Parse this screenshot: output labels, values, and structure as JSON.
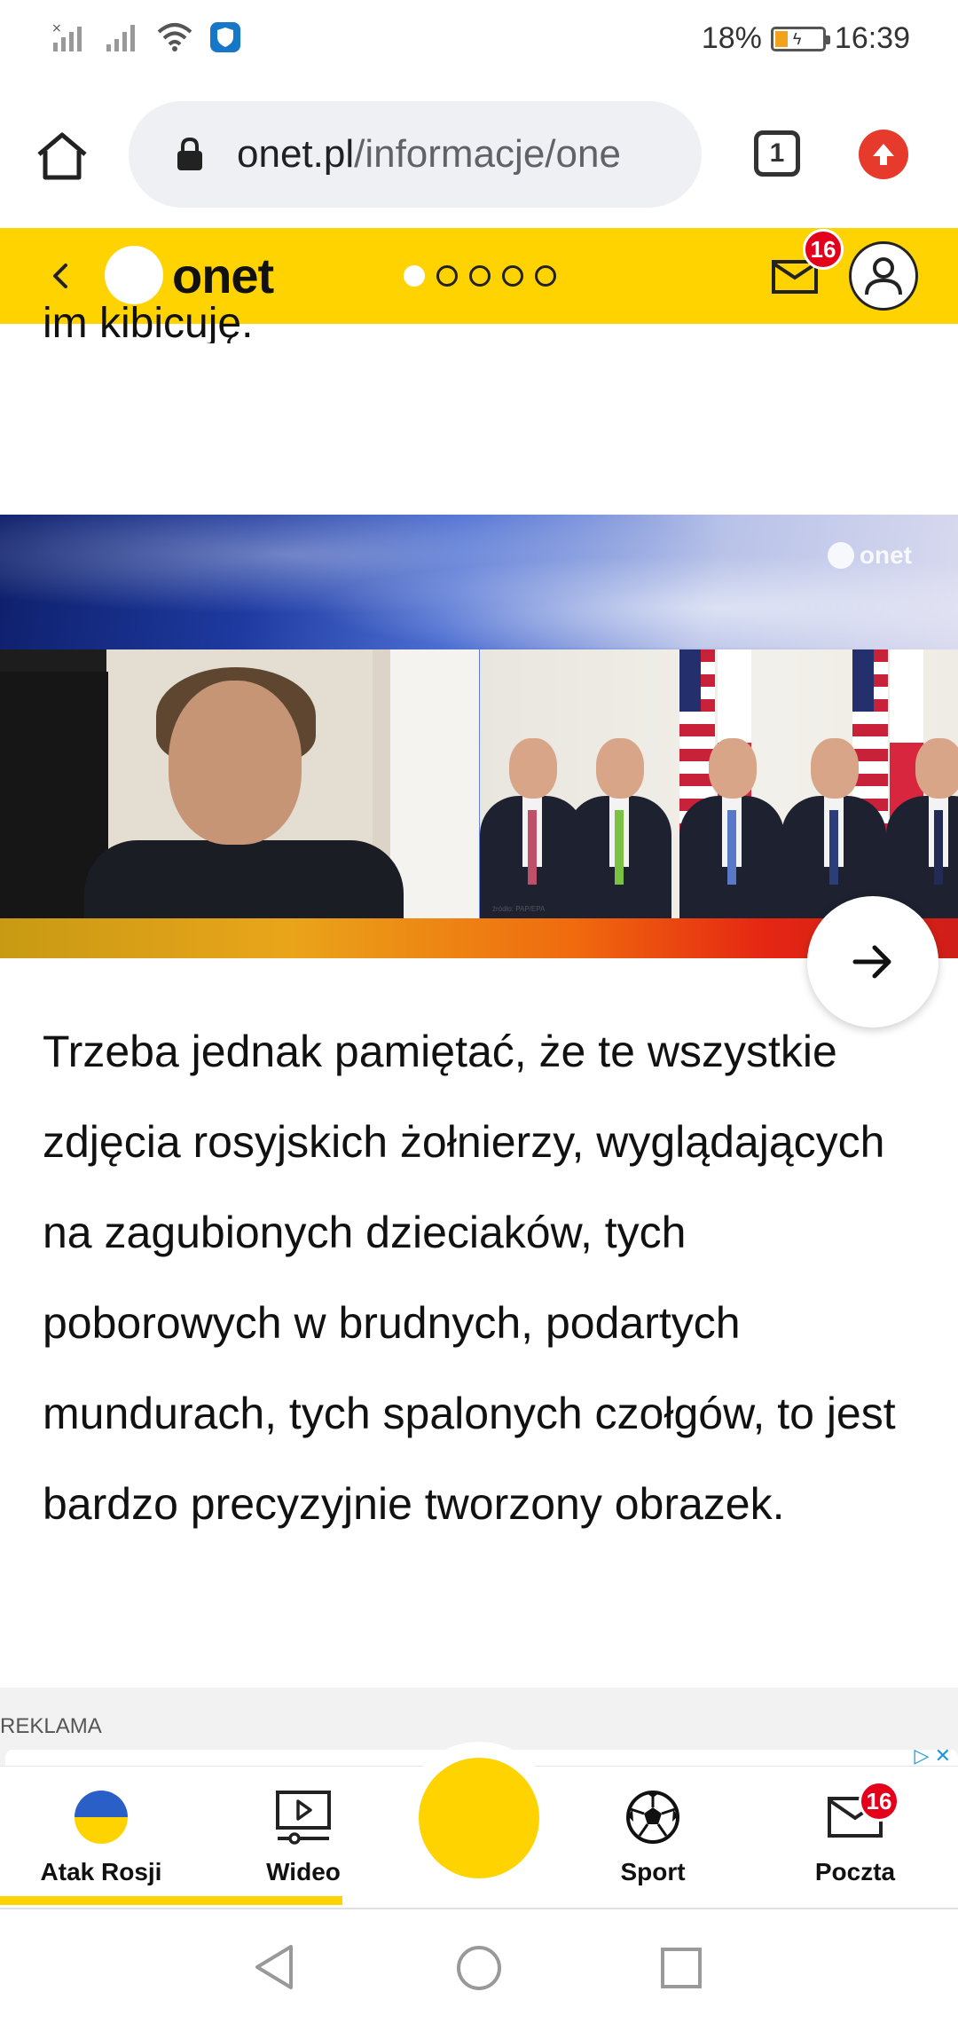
{
  "status_bar": {
    "battery_percent": "18%",
    "time": "16:39"
  },
  "browser": {
    "url_domain": "onet.pl",
    "url_path": "/informacje/one",
    "tab_count": "1"
  },
  "site_header": {
    "logo_text": "onet",
    "pager_total": 5,
    "pager_active": 1,
    "mail_badge": "16"
  },
  "article": {
    "cut_line": "im kibicuję.",
    "video_logo": "onet",
    "photo_credit": "źródło: PAP/EPA",
    "paragraph": "Trzeba jednak pamiętać, że te wszystkie zdjęcia rosyjskich żołnierzy, wyglądających na zagubionych dzieciaków, tych poborowych w brudnych, podartych mundurach, tych spalonych czołgów, to jest bardzo precyzyjnie tworzony obrazek."
  },
  "ad": {
    "label": "REKLAMA"
  },
  "bottom_nav": {
    "items": [
      {
        "label": "Atak Rosji",
        "icon": "ukraine-flag-icon"
      },
      {
        "label": "Wideo",
        "icon": "video-icon"
      },
      {
        "label": "Sport",
        "icon": "soccer-ball-icon"
      },
      {
        "label": "Poczta",
        "icon": "mail-icon",
        "badge": "16"
      }
    ],
    "active_index": 0
  },
  "colors": {
    "brand_yellow": "#ffd300",
    "badge_red": "#e4001b",
    "ukraine_blue": "#2b5fc8",
    "ukraine_yellow": "#ffd300"
  }
}
